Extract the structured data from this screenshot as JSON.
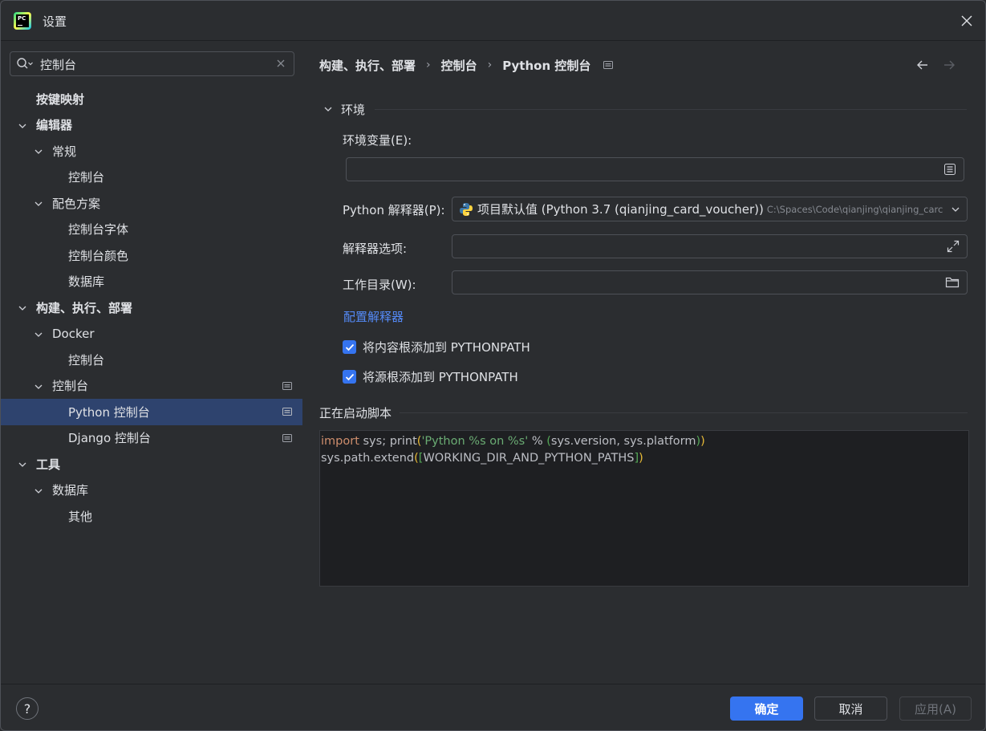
{
  "window": {
    "title": "设置",
    "icons": {
      "app": "pycharm-logo-icon",
      "close": "close-icon"
    },
    "app_logo_text": "PC"
  },
  "search": {
    "value": "控制台",
    "icon": "search-icon",
    "clear_icon": "close-icon"
  },
  "tree": {
    "items": [
      {
        "label": "按键映射",
        "bold": true
      },
      {
        "label": "编辑器",
        "bold": true,
        "expanded": true
      },
      {
        "label": "常规",
        "expanded": true
      },
      {
        "label": "控制台"
      },
      {
        "label": "配色方案",
        "expanded": true
      },
      {
        "label": "控制台字体"
      },
      {
        "label": "控制台颜色"
      },
      {
        "label": "数据库"
      },
      {
        "label": "构建、执行、部署",
        "bold": true,
        "expanded": true
      },
      {
        "label": "Docker",
        "expanded": true
      },
      {
        "label": "控制台"
      },
      {
        "label": "控制台",
        "expanded": true,
        "page_icon": true
      },
      {
        "label": "Python 控制台",
        "selected": true,
        "page_icon": true
      },
      {
        "label": "Django 控制台",
        "page_icon": true
      },
      {
        "label": "工具",
        "bold": true,
        "expanded": true
      },
      {
        "label": "数据库",
        "expanded": true
      },
      {
        "label": "其他"
      }
    ]
  },
  "breadcrumb": {
    "items": [
      "构建、执行、部署",
      "控制台",
      "Python 控制台"
    ],
    "separator": "›",
    "icons": {
      "page": "project-page-icon",
      "back": "arrow-left-icon",
      "forward": "arrow-right-icon"
    }
  },
  "environment": {
    "section_title": "环境",
    "env_vars_label": "环境变量(E):",
    "env_vars_value": "",
    "interpreter_label": "Python 解释器(P):",
    "interpreter_value": "项目默认值 (Python 3.7 (qianjing_card_voucher))",
    "interpreter_path": "C:\\Spaces\\Code\\qianjing\\qianjing_carc",
    "interpreter_options_label": "解释器选项:",
    "interpreter_options_value": "",
    "working_dir_label": "工作目录(W):",
    "working_dir_value": "",
    "configure_link": "配置解释器",
    "checkbox_content_roots": {
      "label": "将内容根添加到 PYTHONPATH",
      "checked": true
    },
    "checkbox_source_roots": {
      "label": "将源根添加到 PYTHONPATH",
      "checked": true
    }
  },
  "startup_script": {
    "title": "正在启动脚本",
    "line1": {
      "kw": "import",
      "a": " sys; ",
      "fn": "print",
      "p1": "(",
      "str": "'Python %s on %s'",
      "b": " % ",
      "p2": "(",
      "args": "sys.version, sys.platform",
      "p3": ")",
      "p4": ")"
    },
    "line2": {
      "a": "sys.path.extend",
      "p1": "(",
      "p2": "[",
      "args": "WORKING_DIR_AND_PYTHON_PATHS",
      "p3": "]",
      "p4": ")"
    }
  },
  "footer": {
    "help": "?",
    "ok": "确定",
    "cancel": "取消",
    "apply": "应用(A)"
  },
  "colors": {
    "background": "#2b2d30",
    "selection": "#2e436e",
    "accent": "#3574f0",
    "link": "#548af7",
    "keyword": "#cf8e6d",
    "string": "#6aab73"
  }
}
